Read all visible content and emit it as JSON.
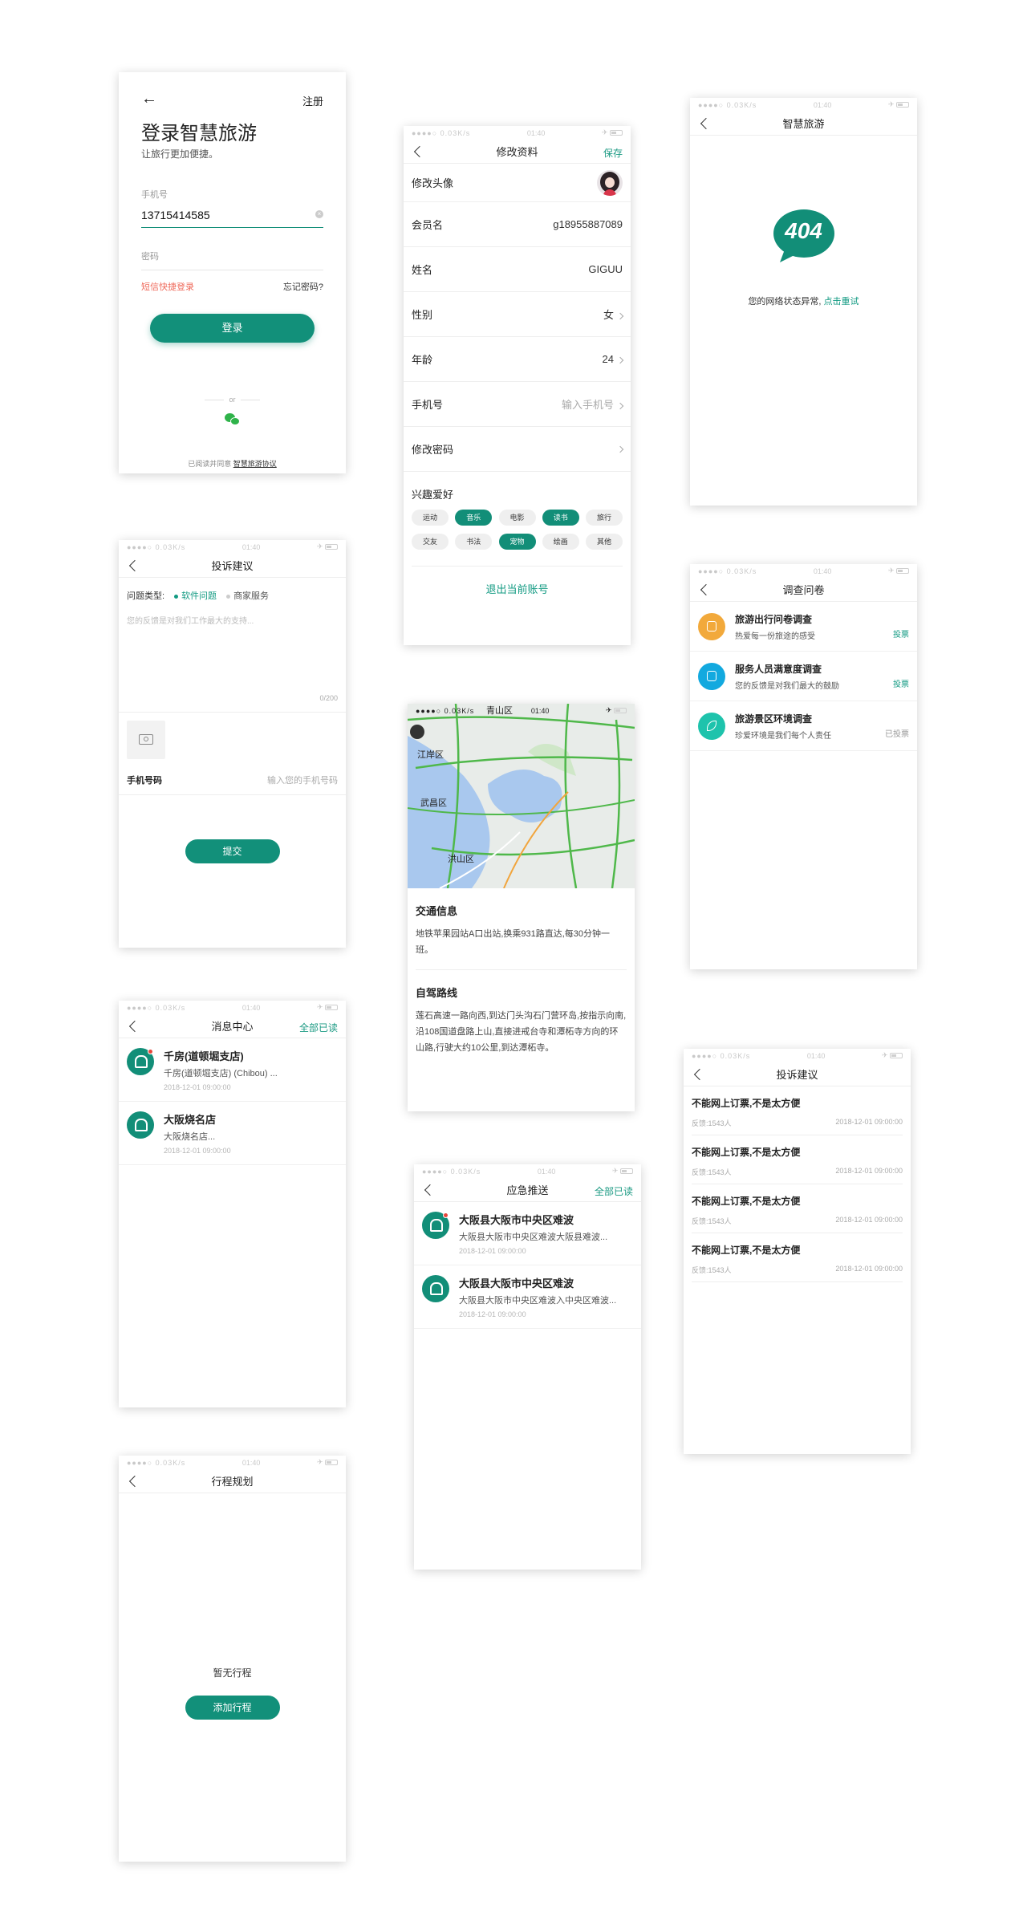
{
  "status": {
    "carrier": "●●●●○ 0.03K/s",
    "time": "01:40",
    "right": "✈ "
  },
  "login": {
    "register": "注册",
    "title": "登录智慧旅游",
    "subtitle": "让旅行更加便捷。",
    "phone_label": "手机号",
    "phone_value": "13715414585",
    "password_label": "密码",
    "sms_login": "短信快捷登录",
    "forgot": "忘记密码?",
    "login_button": "登录",
    "or": "or",
    "agreement_prefix": "已阅读并同意",
    "agreement_link": "智慧旅游协议"
  },
  "profile": {
    "nav_title": "修改资料",
    "save": "保存",
    "rows": [
      {
        "label": "修改头像",
        "value": ""
      },
      {
        "label": "会员名",
        "value": "g18955887089"
      },
      {
        "label": "姓名",
        "value": "GIGUU"
      },
      {
        "label": "性别",
        "value": "女"
      },
      {
        "label": "年龄",
        "value": "24"
      },
      {
        "label": "手机号",
        "value": "输入手机号"
      },
      {
        "label": "修改密码",
        "value": ""
      }
    ],
    "hobby_label": "兴趣爱好",
    "hobbies_row1": [
      "运动",
      "音乐",
      "电影",
      "读书",
      "旅行"
    ],
    "hobbies_row2": [
      "交友",
      "书法",
      "宠物",
      "绘画",
      "其他"
    ],
    "logout": "退出当前账号"
  },
  "error404": {
    "nav_title": "智慧旅游",
    "code": "404",
    "message": "您的网络状态异常,",
    "retry": "点击重试"
  },
  "complaint": {
    "nav_title": "投诉建议",
    "type_label": "问题类型:",
    "type_software": "软件问题",
    "type_merchant": "商家服务",
    "placeholder": "您的反馈是对我们工作最大的支持...",
    "counter": "0/200",
    "phone_label": "手机号码",
    "phone_placeholder": "输入您的手机号码",
    "submit": "提交"
  },
  "survey": {
    "nav_title": "调查问卷",
    "items": [
      {
        "title": "旅游出行问卷调查",
        "desc": "热爱每一份旅途的感受",
        "action": "投票",
        "color": "#f2a93b"
      },
      {
        "title": "服务人员满意度调查",
        "desc": "您的反馈是对我们最大的鼓励",
        "action": "投票",
        "color": "#12a9df"
      },
      {
        "title": "旅游景区环境调查",
        "desc": "珍爱环境是我们每个人责任",
        "action": "已投票",
        "color": "#1ec3ac"
      }
    ]
  },
  "map": {
    "labels": [
      "青山区",
      "江岸区",
      "武昌区",
      "洪山区"
    ],
    "traffic_title": "交通信息",
    "traffic_text": "地铁苹果园站A口出站,换乘931路直达,每30分钟一班。",
    "drive_title": "自驾路线",
    "drive_text": "莲石高速一路向西,到达门头沟石门营环岛,按指示向南,沿108国道盘路上山,直接进戒台寺和潭柘寺方向的环山路,行驶大约10公里,到达潭柘寺。"
  },
  "messages": {
    "nav_title": "消息中心",
    "mark_all": "全部已读",
    "items": [
      {
        "title": "千房(道顿堀支店)",
        "desc": "千房(道顿堀支店) (Chibou) ...",
        "time": "2018-12-01   09:00:00",
        "unread": true
      },
      {
        "title": "大阪烧名店",
        "desc": "大阪烧名店...",
        "time": "2018-12-01   09:00:00",
        "unread": false
      }
    ]
  },
  "emergency": {
    "nav_title": "应急推送",
    "mark_all": "全部已读",
    "items": [
      {
        "title": "大阪县大阪市中央区难波",
        "desc": "大阪县大阪市中央区难波大阪县难波...",
        "time": "2018-12-01   09:00:00",
        "unread": true
      },
      {
        "title": "大阪县大阪市中央区难波",
        "desc": "大阪县大阪市中央区难波入中央区难波...",
        "time": "2018-12-01   09:00:00",
        "unread": false
      }
    ]
  },
  "complaint_list": {
    "nav_title": "投诉建议",
    "items": [
      {
        "title": "不能网上订票,不是太方便",
        "meta": "反馈:1543人",
        "time": "2018-12-01   09:00:00"
      },
      {
        "title": "不能网上订票,不是太方便",
        "meta": "反馈:1543人",
        "time": "2018-12-01   09:00:00"
      },
      {
        "title": "不能网上订票,不是太方便",
        "meta": "反馈:1543人",
        "time": "2018-12-01   09:00:00"
      },
      {
        "title": "不能网上订票,不是太方便",
        "meta": "反馈:1543人",
        "time": "2018-12-01   09:00:00"
      }
    ]
  },
  "itinerary": {
    "nav_title": "行程规划",
    "empty": "暂无行程",
    "add": "添加行程"
  }
}
